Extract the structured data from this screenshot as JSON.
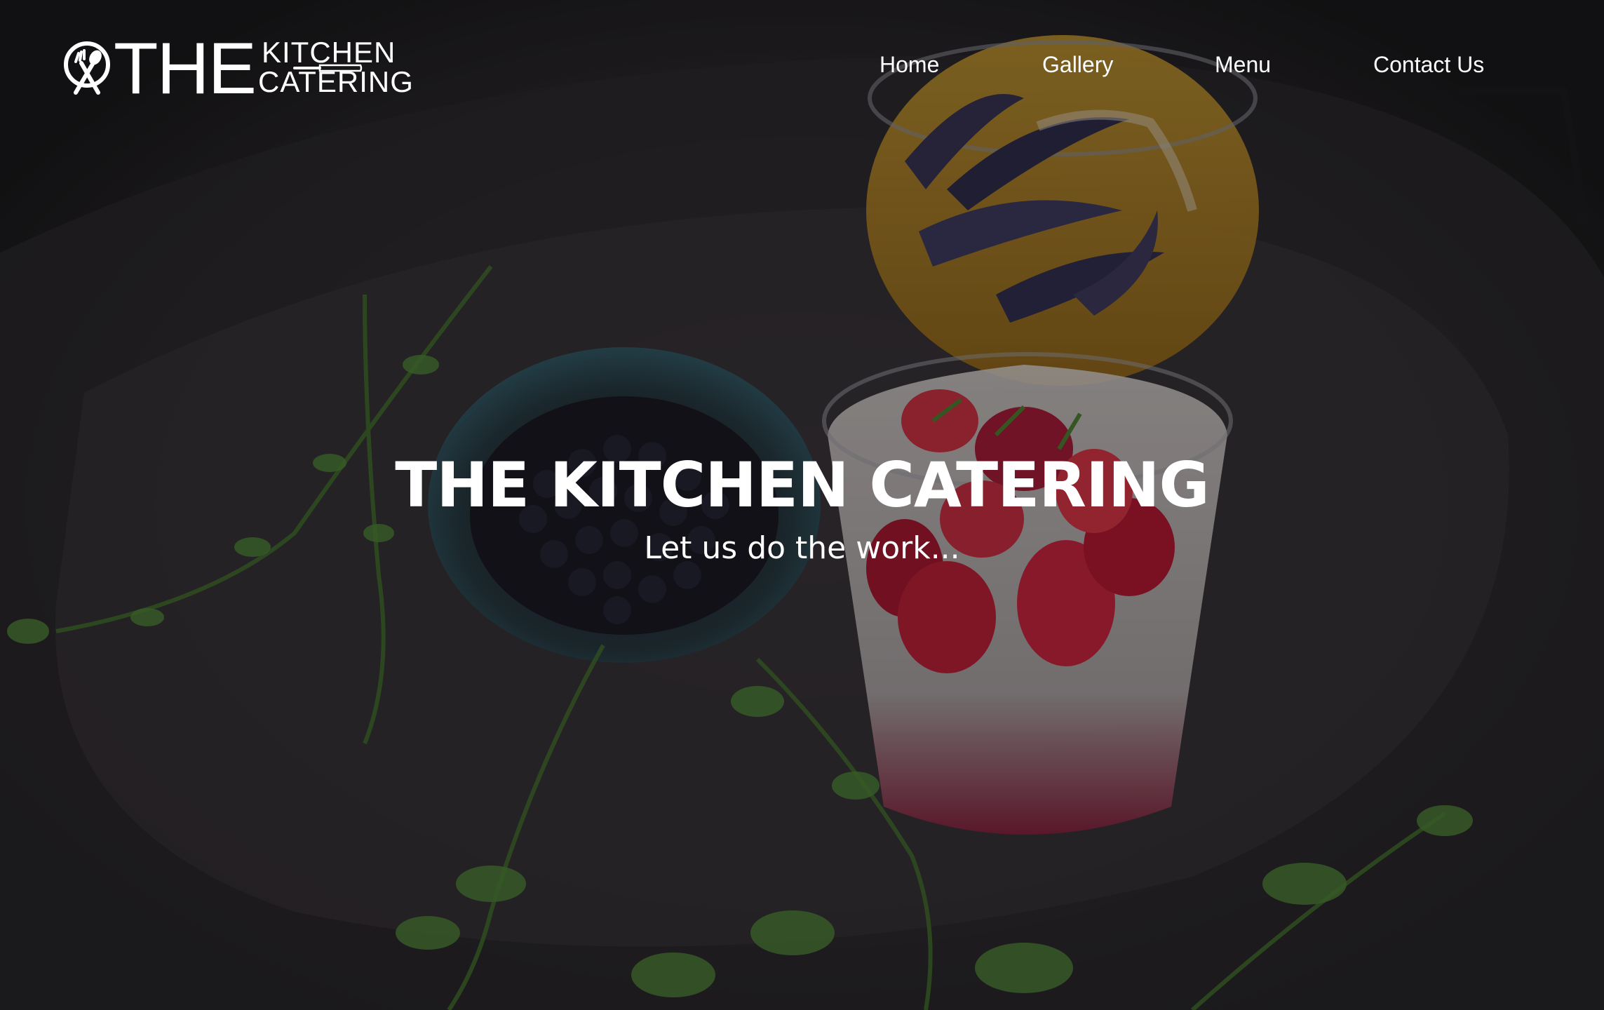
{
  "brand": {
    "logo_the": "THE",
    "logo_kitchen": "KITCHEN",
    "logo_catering": "CATERING"
  },
  "nav": {
    "items": [
      {
        "label": "Home"
      },
      {
        "label": "Gallery"
      },
      {
        "label": "Menu"
      },
      {
        "label": "Contact Us"
      }
    ]
  },
  "hero": {
    "title": "THE KITCHEN CATERING",
    "subtitle": "Let us do the work...",
    "image_icon": "food-photo"
  },
  "colors": {
    "text": "#ffffff",
    "overlay": "#0a0a0c"
  }
}
